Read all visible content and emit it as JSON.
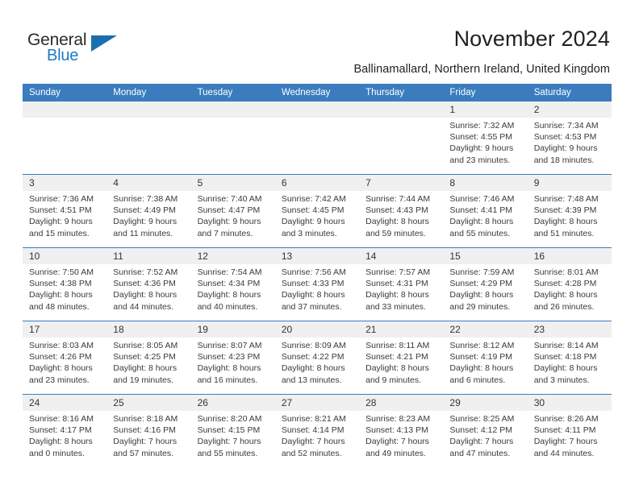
{
  "brand": {
    "name_part1": "General",
    "name_part2": "Blue",
    "accent_color": "#1b6fae",
    "logo_icon": "triangle-icon"
  },
  "header": {
    "title": "November 2024",
    "subtitle": "Ballinamallard, Northern Ireland, United Kingdom"
  },
  "calendar": {
    "header_bg": "#3a7cbe",
    "daynum_bg": "#f0f0f0",
    "weekday_names": [
      "Sunday",
      "Monday",
      "Tuesday",
      "Wednesday",
      "Thursday",
      "Friday",
      "Saturday"
    ],
    "weeks": [
      {
        "numbers": [
          "",
          "",
          "",
          "",
          "",
          "1",
          "2"
        ],
        "cells": [
          {
            "lines": []
          },
          {
            "lines": []
          },
          {
            "lines": []
          },
          {
            "lines": []
          },
          {
            "lines": []
          },
          {
            "lines": [
              "Sunrise: 7:32 AM",
              "Sunset: 4:55 PM",
              "Daylight: 9 hours",
              "and 23 minutes."
            ]
          },
          {
            "lines": [
              "Sunrise: 7:34 AM",
              "Sunset: 4:53 PM",
              "Daylight: 9 hours",
              "and 18 minutes."
            ]
          }
        ]
      },
      {
        "numbers": [
          "3",
          "4",
          "5",
          "6",
          "7",
          "8",
          "9"
        ],
        "cells": [
          {
            "lines": [
              "Sunrise: 7:36 AM",
              "Sunset: 4:51 PM",
              "Daylight: 9 hours",
              "and 15 minutes."
            ]
          },
          {
            "lines": [
              "Sunrise: 7:38 AM",
              "Sunset: 4:49 PM",
              "Daylight: 9 hours",
              "and 11 minutes."
            ]
          },
          {
            "lines": [
              "Sunrise: 7:40 AM",
              "Sunset: 4:47 PM",
              "Daylight: 9 hours",
              "and 7 minutes."
            ]
          },
          {
            "lines": [
              "Sunrise: 7:42 AM",
              "Sunset: 4:45 PM",
              "Daylight: 9 hours",
              "and 3 minutes."
            ]
          },
          {
            "lines": [
              "Sunrise: 7:44 AM",
              "Sunset: 4:43 PM",
              "Daylight: 8 hours",
              "and 59 minutes."
            ]
          },
          {
            "lines": [
              "Sunrise: 7:46 AM",
              "Sunset: 4:41 PM",
              "Daylight: 8 hours",
              "and 55 minutes."
            ]
          },
          {
            "lines": [
              "Sunrise: 7:48 AM",
              "Sunset: 4:39 PM",
              "Daylight: 8 hours",
              "and 51 minutes."
            ]
          }
        ]
      },
      {
        "numbers": [
          "10",
          "11",
          "12",
          "13",
          "14",
          "15",
          "16"
        ],
        "cells": [
          {
            "lines": [
              "Sunrise: 7:50 AM",
              "Sunset: 4:38 PM",
              "Daylight: 8 hours",
              "and 48 minutes."
            ]
          },
          {
            "lines": [
              "Sunrise: 7:52 AM",
              "Sunset: 4:36 PM",
              "Daylight: 8 hours",
              "and 44 minutes."
            ]
          },
          {
            "lines": [
              "Sunrise: 7:54 AM",
              "Sunset: 4:34 PM",
              "Daylight: 8 hours",
              "and 40 minutes."
            ]
          },
          {
            "lines": [
              "Sunrise: 7:56 AM",
              "Sunset: 4:33 PM",
              "Daylight: 8 hours",
              "and 37 minutes."
            ]
          },
          {
            "lines": [
              "Sunrise: 7:57 AM",
              "Sunset: 4:31 PM",
              "Daylight: 8 hours",
              "and 33 minutes."
            ]
          },
          {
            "lines": [
              "Sunrise: 7:59 AM",
              "Sunset: 4:29 PM",
              "Daylight: 8 hours",
              "and 29 minutes."
            ]
          },
          {
            "lines": [
              "Sunrise: 8:01 AM",
              "Sunset: 4:28 PM",
              "Daylight: 8 hours",
              "and 26 minutes."
            ]
          }
        ]
      },
      {
        "numbers": [
          "17",
          "18",
          "19",
          "20",
          "21",
          "22",
          "23"
        ],
        "cells": [
          {
            "lines": [
              "Sunrise: 8:03 AM",
              "Sunset: 4:26 PM",
              "Daylight: 8 hours",
              "and 23 minutes."
            ]
          },
          {
            "lines": [
              "Sunrise: 8:05 AM",
              "Sunset: 4:25 PM",
              "Daylight: 8 hours",
              "and 19 minutes."
            ]
          },
          {
            "lines": [
              "Sunrise: 8:07 AM",
              "Sunset: 4:23 PM",
              "Daylight: 8 hours",
              "and 16 minutes."
            ]
          },
          {
            "lines": [
              "Sunrise: 8:09 AM",
              "Sunset: 4:22 PM",
              "Daylight: 8 hours",
              "and 13 minutes."
            ]
          },
          {
            "lines": [
              "Sunrise: 8:11 AM",
              "Sunset: 4:21 PM",
              "Daylight: 8 hours",
              "and 9 minutes."
            ]
          },
          {
            "lines": [
              "Sunrise: 8:12 AM",
              "Sunset: 4:19 PM",
              "Daylight: 8 hours",
              "and 6 minutes."
            ]
          },
          {
            "lines": [
              "Sunrise: 8:14 AM",
              "Sunset: 4:18 PM",
              "Daylight: 8 hours",
              "and 3 minutes."
            ]
          }
        ]
      },
      {
        "numbers": [
          "24",
          "25",
          "26",
          "27",
          "28",
          "29",
          "30"
        ],
        "cells": [
          {
            "lines": [
              "Sunrise: 8:16 AM",
              "Sunset: 4:17 PM",
              "Daylight: 8 hours",
              "and 0 minutes."
            ]
          },
          {
            "lines": [
              "Sunrise: 8:18 AM",
              "Sunset: 4:16 PM",
              "Daylight: 7 hours",
              "and 57 minutes."
            ]
          },
          {
            "lines": [
              "Sunrise: 8:20 AM",
              "Sunset: 4:15 PM",
              "Daylight: 7 hours",
              "and 55 minutes."
            ]
          },
          {
            "lines": [
              "Sunrise: 8:21 AM",
              "Sunset: 4:14 PM",
              "Daylight: 7 hours",
              "and 52 minutes."
            ]
          },
          {
            "lines": [
              "Sunrise: 8:23 AM",
              "Sunset: 4:13 PM",
              "Daylight: 7 hours",
              "and 49 minutes."
            ]
          },
          {
            "lines": [
              "Sunrise: 8:25 AM",
              "Sunset: 4:12 PM",
              "Daylight: 7 hours",
              "and 47 minutes."
            ]
          },
          {
            "lines": [
              "Sunrise: 8:26 AM",
              "Sunset: 4:11 PM",
              "Daylight: 7 hours",
              "and 44 minutes."
            ]
          }
        ]
      }
    ]
  }
}
